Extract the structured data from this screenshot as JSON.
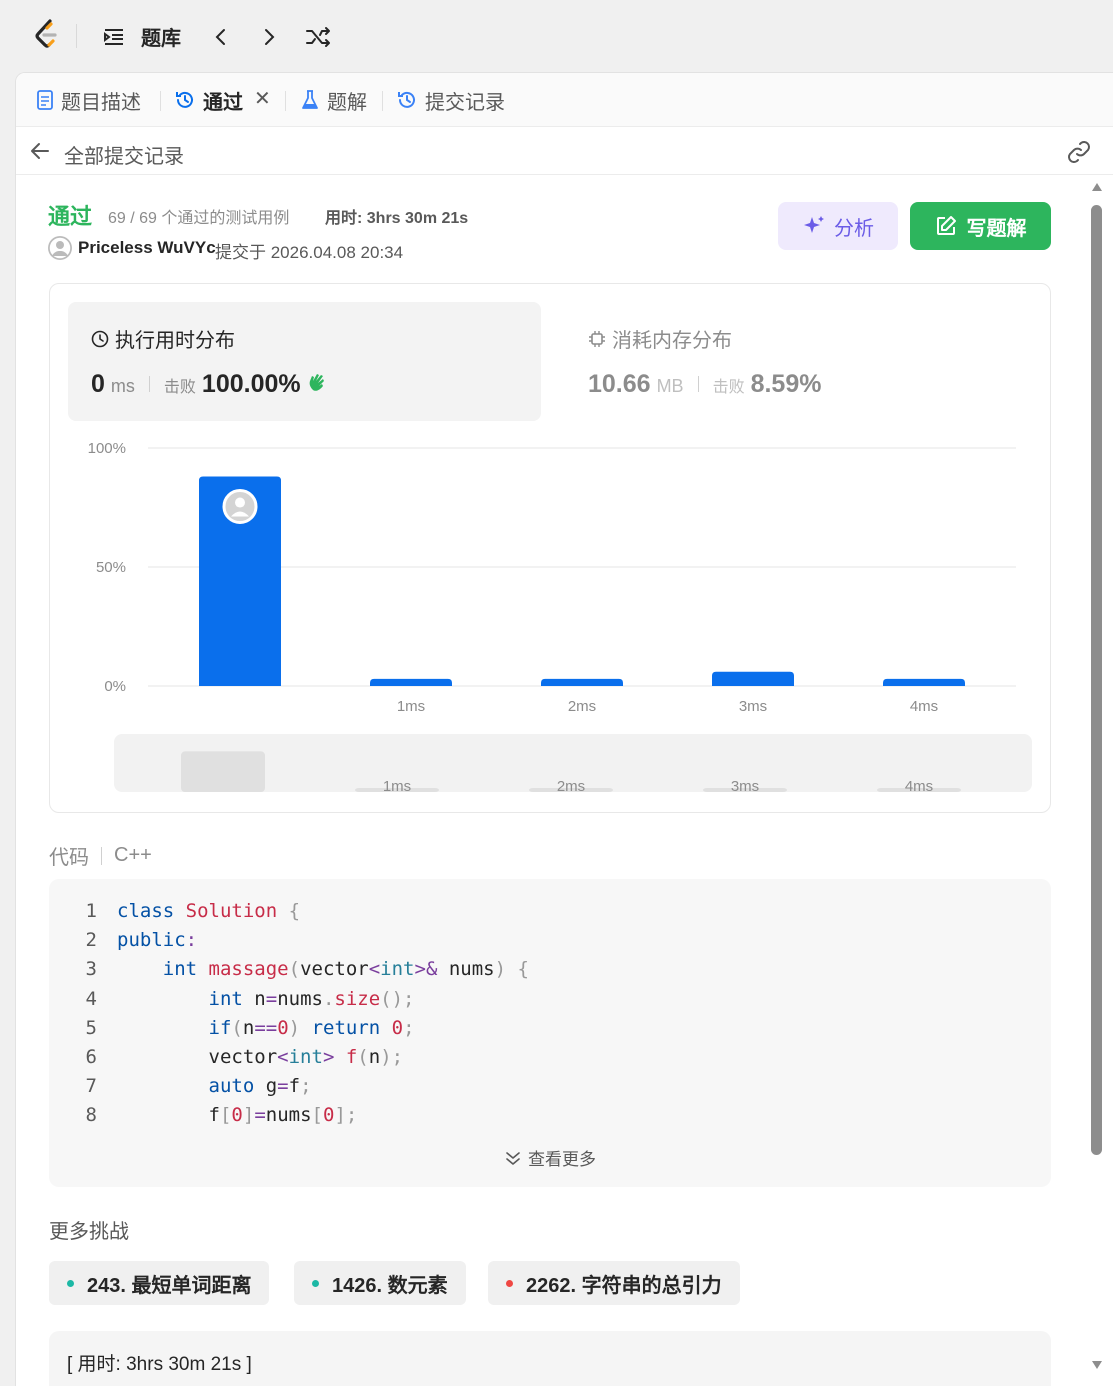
{
  "topbar": {
    "title": "题库"
  },
  "tabs": [
    {
      "label": "题目描述"
    },
    {
      "label": "通过",
      "active": true
    },
    {
      "label": "题解"
    },
    {
      "label": "提交记录"
    }
  ],
  "subbar": {
    "title": "全部提交记录"
  },
  "submission": {
    "status": "通过",
    "cases": "69 / 69 个通过的测试用例",
    "runtime_label": "用时: 3hrs 30m 21s",
    "author": "Priceless WuVYc",
    "submitted_at": "提交于 2026.04.08 20:34"
  },
  "buttons": {
    "analyze": "分析",
    "write_solution": "写题解"
  },
  "stats": {
    "time": {
      "title": "执行用时分布",
      "value": "0",
      "unit": "ms",
      "beat_label": "击败",
      "beat_value": "100.00%"
    },
    "memory": {
      "title": "消耗内存分布",
      "value": "10.66",
      "unit": "MB",
      "beat_label": "击败",
      "beat_value": "8.59%"
    }
  },
  "chart_data": {
    "type": "bar",
    "categories": [
      "0ms",
      "1ms",
      "2ms",
      "3ms",
      "4ms"
    ],
    "tick_labels": [
      "",
      "1ms",
      "2ms",
      "3ms",
      "4ms"
    ],
    "values": [
      88,
      3,
      3,
      6,
      3
    ],
    "yticks": [
      "100%",
      "50%",
      "0%"
    ],
    "ylim": [
      0,
      100
    ],
    "color": "#0a6fec",
    "overview_values": [
      42,
      3,
      3,
      3,
      3
    ],
    "highlight_category": "0ms"
  },
  "code": {
    "label": "代码",
    "language": "C++",
    "more_label": "查看更多"
  },
  "more_challenges": {
    "title": "更多挑战",
    "items": [
      {
        "label": "243. 最短单词距离",
        "color": "#1cb8a5"
      },
      {
        "label": "1426. 数元素",
        "color": "#1cb8a5"
      },
      {
        "label": "2262. 字符串的总引力",
        "color": "#ef4743"
      }
    ]
  },
  "note": {
    "text": "[ 用时: 3hrs 30m 21s ]"
  }
}
